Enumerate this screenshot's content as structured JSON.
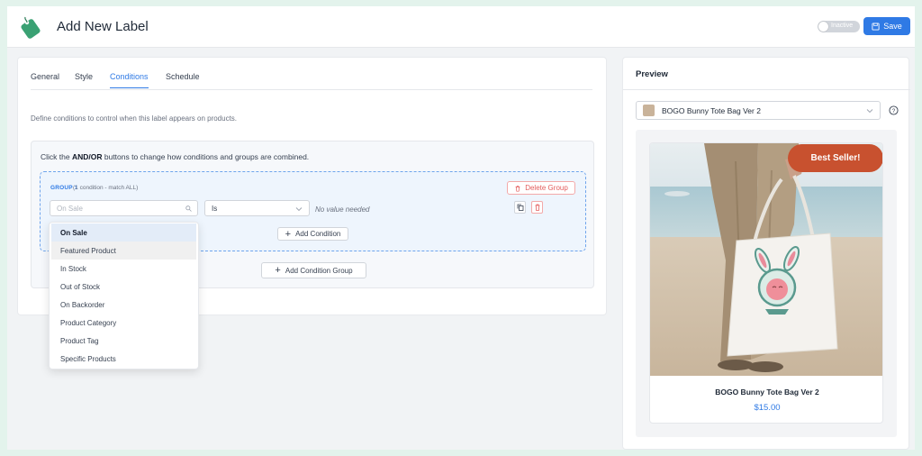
{
  "header": {
    "title": "Add New Label",
    "status_toggle": "Inactive",
    "save_label": "Save"
  },
  "tabs": [
    {
      "label": "General",
      "active": false
    },
    {
      "label": "Style",
      "active": false
    },
    {
      "label": "Conditions",
      "active": true
    },
    {
      "label": "Schedule",
      "active": false
    }
  ],
  "conditions": {
    "description": "Define conditions to control when this label appears on products.",
    "hint_prefix": "Click the ",
    "hint_bold": "AND/OR",
    "hint_suffix": " buttons to change how conditions and groups are combined.",
    "group": {
      "title": "GROUP 1",
      "subtitle": "(1 condition - match ALL)",
      "delete_label": "Delete Group",
      "field_placeholder": "On Sale",
      "operator": "Is",
      "value_text": "No value needed",
      "add_condition_label": "Add Condition"
    },
    "add_group_label": "Add Condition Group"
  },
  "dropdown": {
    "options": [
      "On Sale",
      "Featured Product",
      "In Stock",
      "Out of Stock",
      "On Backorder",
      "Product Category",
      "Product Tag",
      "Specific Products"
    ],
    "selected": "On Sale",
    "hovered": "Featured Product"
  },
  "preview": {
    "title": "Preview",
    "product_select": "BOGO Bunny Tote Bag Ver 2",
    "badge": "Best Seller!",
    "product_name": "BOGO Bunny Tote Bag Ver 2",
    "product_price": "$15.00"
  },
  "colors": {
    "accent": "#2f7ae5",
    "badge": "#c8512f",
    "danger": "#e35d5d"
  }
}
